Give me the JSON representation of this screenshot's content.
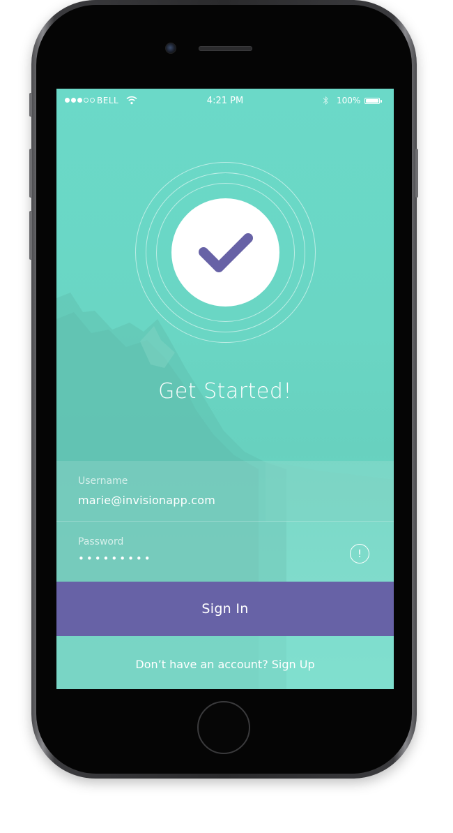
{
  "status_bar": {
    "carrier": "BELL",
    "time": "4:21 PM",
    "battery_percent": "100%",
    "signal_dots_filled": 3,
    "signal_dots_total": 5,
    "icons": [
      "signal-dots-icon",
      "wifi-icon",
      "bluetooth-icon",
      "battery-icon"
    ]
  },
  "logo": {
    "icon": "checkmark-icon",
    "color": "#6762a6"
  },
  "title": "Get Started!",
  "form": {
    "username_label": "Username",
    "username_value": "marie@invisionapp.com",
    "password_label": "Password",
    "password_value": "•••••••••",
    "password_alert_icon": "alert-circle-icon",
    "password_alert_glyph": "!"
  },
  "actions": {
    "sign_in_label": "Sign In",
    "sign_up_prompt": "Don’t have an account? Sign Up"
  },
  "colors": {
    "background_teal": "#6dd8c6",
    "button_purple": "#6762a6",
    "text": "#ffffff"
  }
}
